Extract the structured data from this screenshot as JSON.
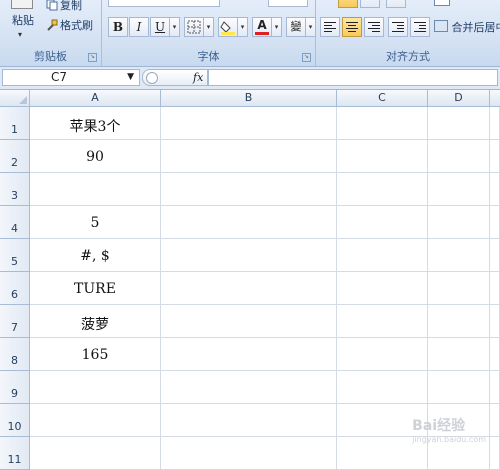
{
  "ribbon": {
    "clipboard": {
      "group_label": "剪贴板",
      "paste_label": "粘贴",
      "copy_label": "复制",
      "format_painter_label": "格式刷"
    },
    "font": {
      "group_label": "字体",
      "bold": "B",
      "italic": "I",
      "underline": "U",
      "font_color_glyph": "A",
      "font_color": "#e02020",
      "fill_color": "#ffe84a",
      "phonetic_glyph": "變"
    },
    "alignment": {
      "group_label": "对齐方式",
      "merge_center_label": "合并后居中"
    }
  },
  "formula_bar": {
    "name_box_value": "C7",
    "fx_label": "fx",
    "formula_value": ""
  },
  "grid": {
    "columns": [
      "A",
      "B",
      "C",
      "D"
    ],
    "rows": [
      {
        "num": "1",
        "a": "苹果3个"
      },
      {
        "num": "2",
        "a": "90"
      },
      {
        "num": "3",
        "a": ""
      },
      {
        "num": "4",
        "a": "5"
      },
      {
        "num": "5",
        "a": "#, $"
      },
      {
        "num": "6",
        "a": "TURE"
      },
      {
        "num": "7",
        "a": "菠萝"
      },
      {
        "num": "8",
        "a": "165"
      },
      {
        "num": "9",
        "a": ""
      },
      {
        "num": "10",
        "a": ""
      },
      {
        "num": "11",
        "a": ""
      }
    ]
  },
  "watermark": {
    "text": "Bai经验",
    "sub": "jingyan.baidu.com"
  }
}
